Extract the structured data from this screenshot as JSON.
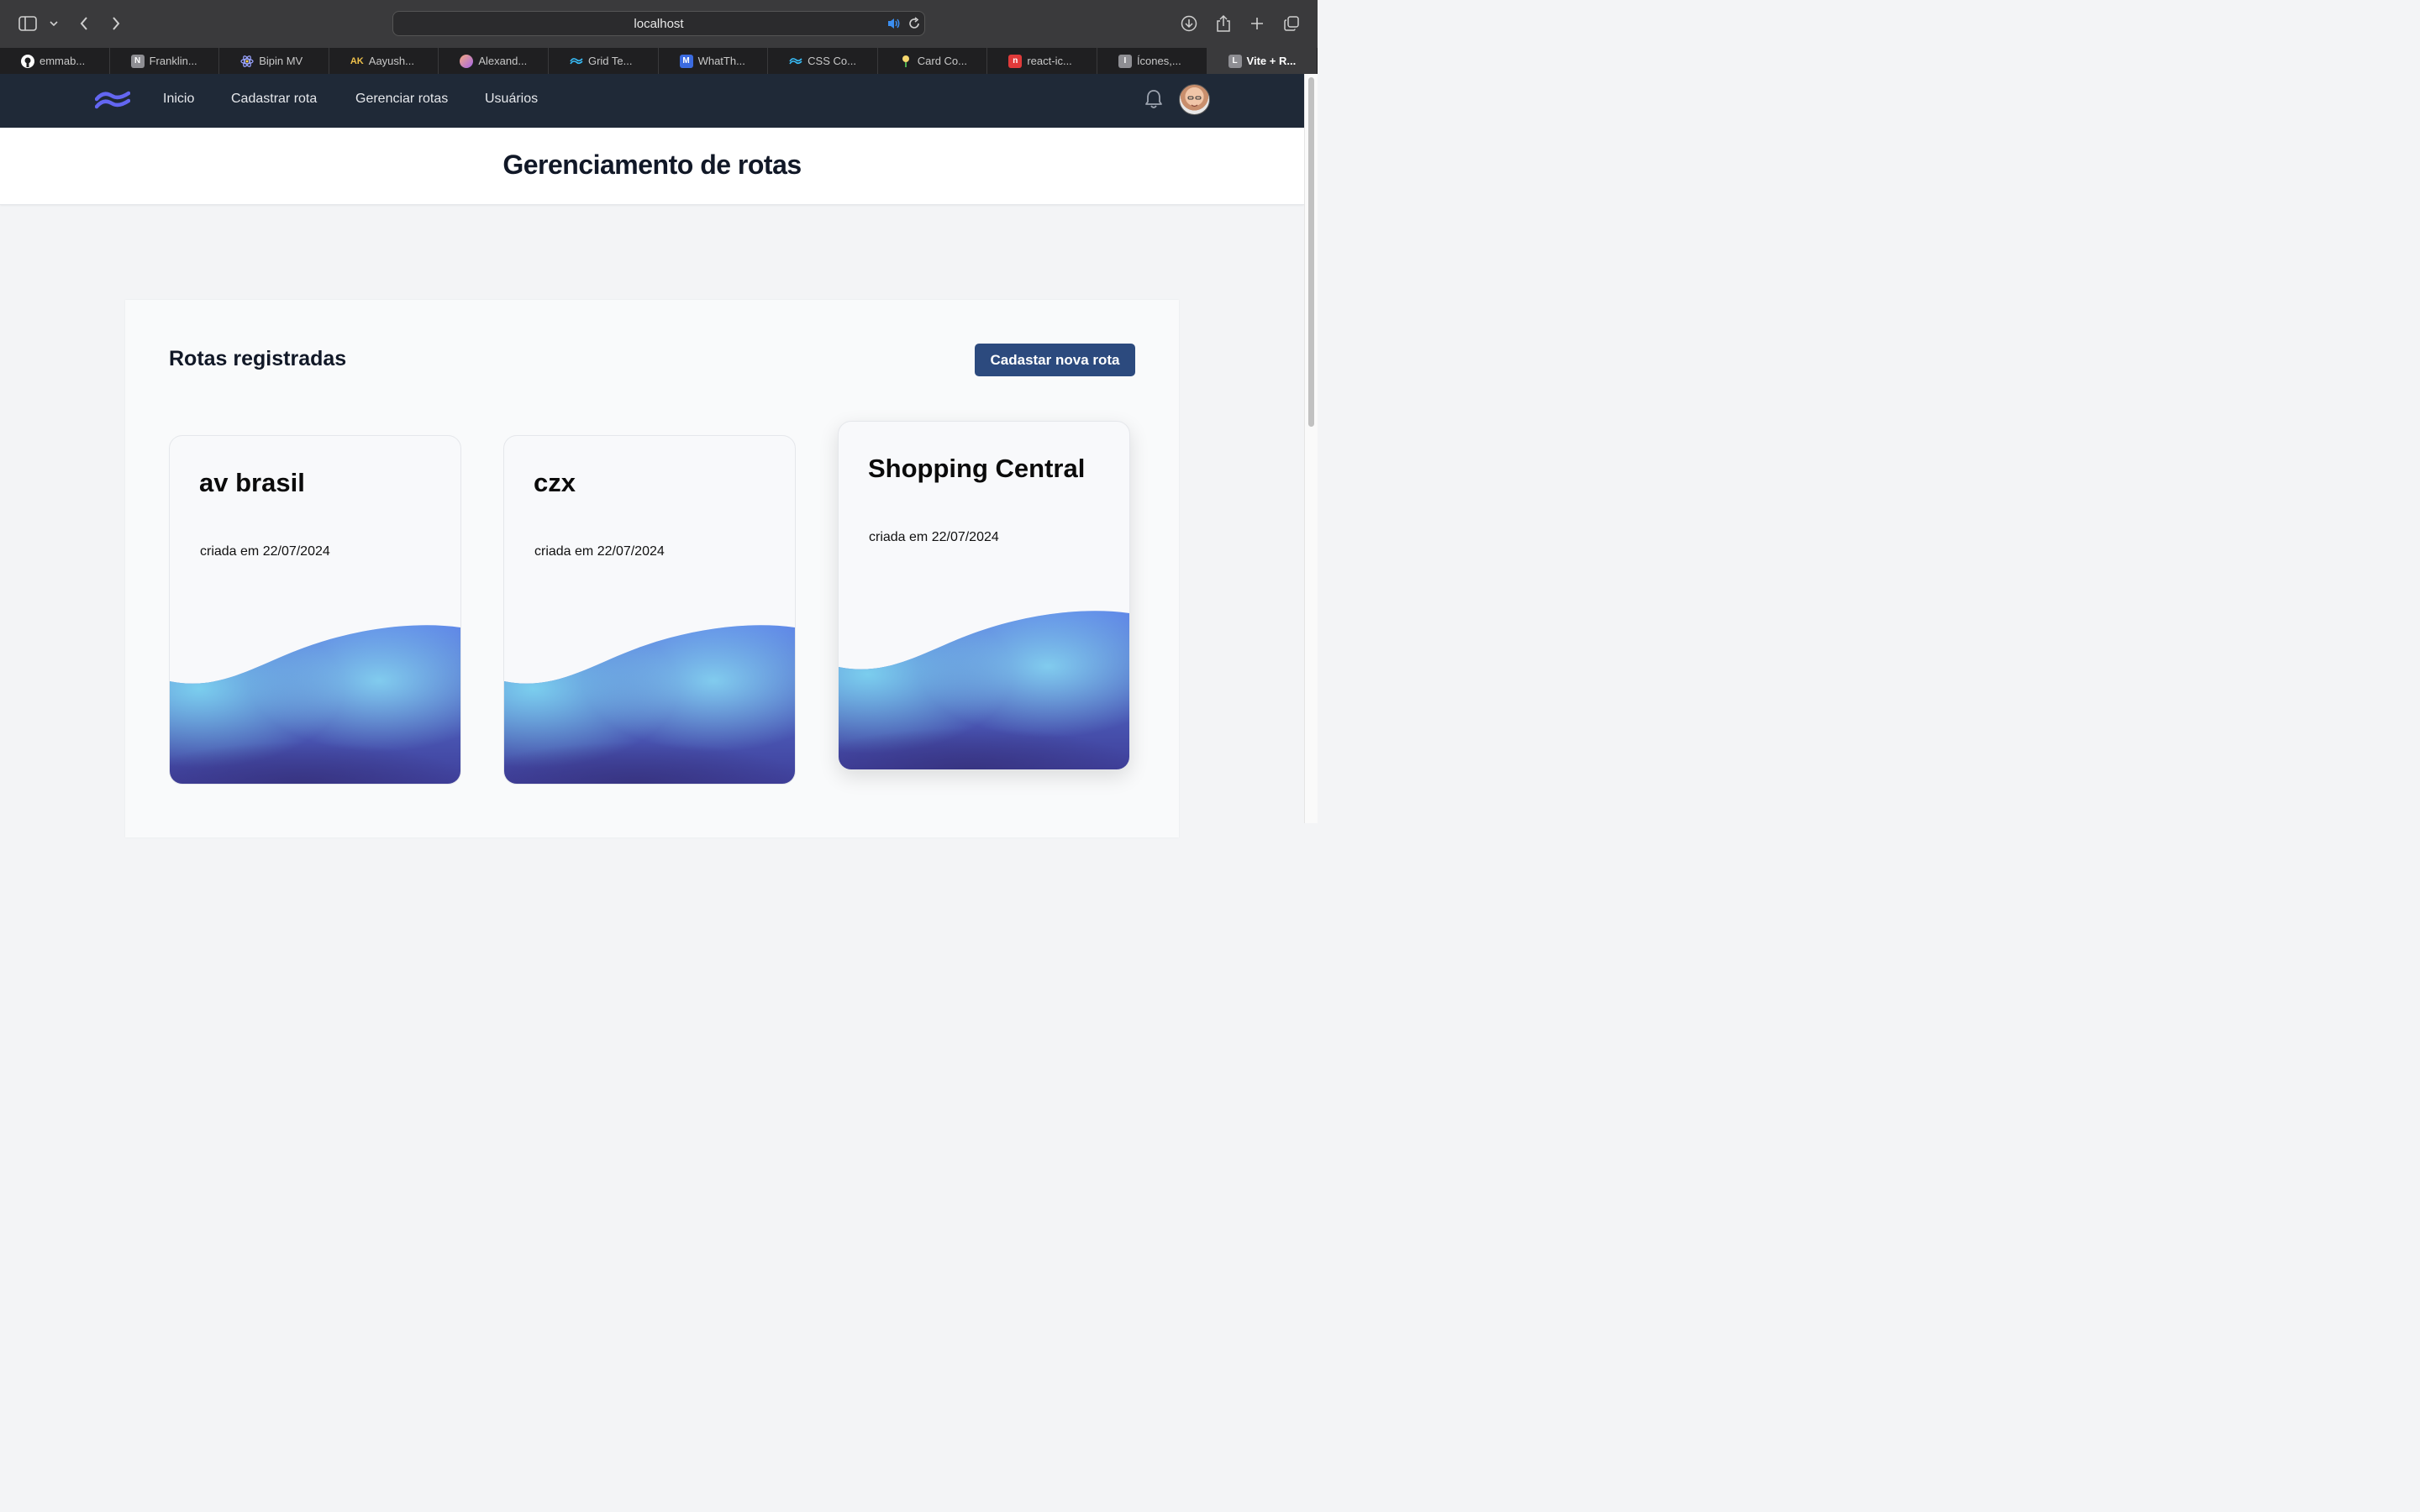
{
  "browser": {
    "url": "localhost",
    "tabs": [
      {
        "label": "emmab...",
        "icon": "github-icon"
      },
      {
        "label": "Franklin...",
        "icon": "notion-icon"
      },
      {
        "label": "Bipin MV",
        "icon": "atom-icon"
      },
      {
        "label": "Aayush...",
        "icon": "ak-icon"
      },
      {
        "label": "Alexand...",
        "icon": "avatar-icon"
      },
      {
        "label": "Grid Te...",
        "icon": "tailwind-icon"
      },
      {
        "label": "WhatTh...",
        "icon": "whatthefont-icon"
      },
      {
        "label": "CSS Co...",
        "icon": "tailwind-icon"
      },
      {
        "label": "Card Co...",
        "icon": "leaf-icon"
      },
      {
        "label": "react-ic...",
        "icon": "react-icons-icon"
      },
      {
        "label": "Ícones,...",
        "icon": "i-icon"
      },
      {
        "label": "Vite + R...",
        "icon": "l-icon"
      }
    ]
  },
  "nav": {
    "links": [
      "Inicio",
      "Cadastrar rota",
      "Gerenciar rotas",
      "Usuários"
    ]
  },
  "page": {
    "title": "Gerenciamento de rotas"
  },
  "routes": {
    "heading": "Rotas registradas",
    "new_button": "Cadastar nova rota",
    "cards": [
      {
        "name": "av brasil",
        "created": "criada em 22/07/2024"
      },
      {
        "name": "czx",
        "created": "criada em 22/07/2024"
      },
      {
        "name": "Shopping Central",
        "created": "criada em 22/07/2024"
      }
    ]
  },
  "colors": {
    "navbar": "#1f2937",
    "button": "#2c4a7e",
    "wave_dark": "#3b3f9e",
    "wave_light": "#6ec3ec"
  }
}
